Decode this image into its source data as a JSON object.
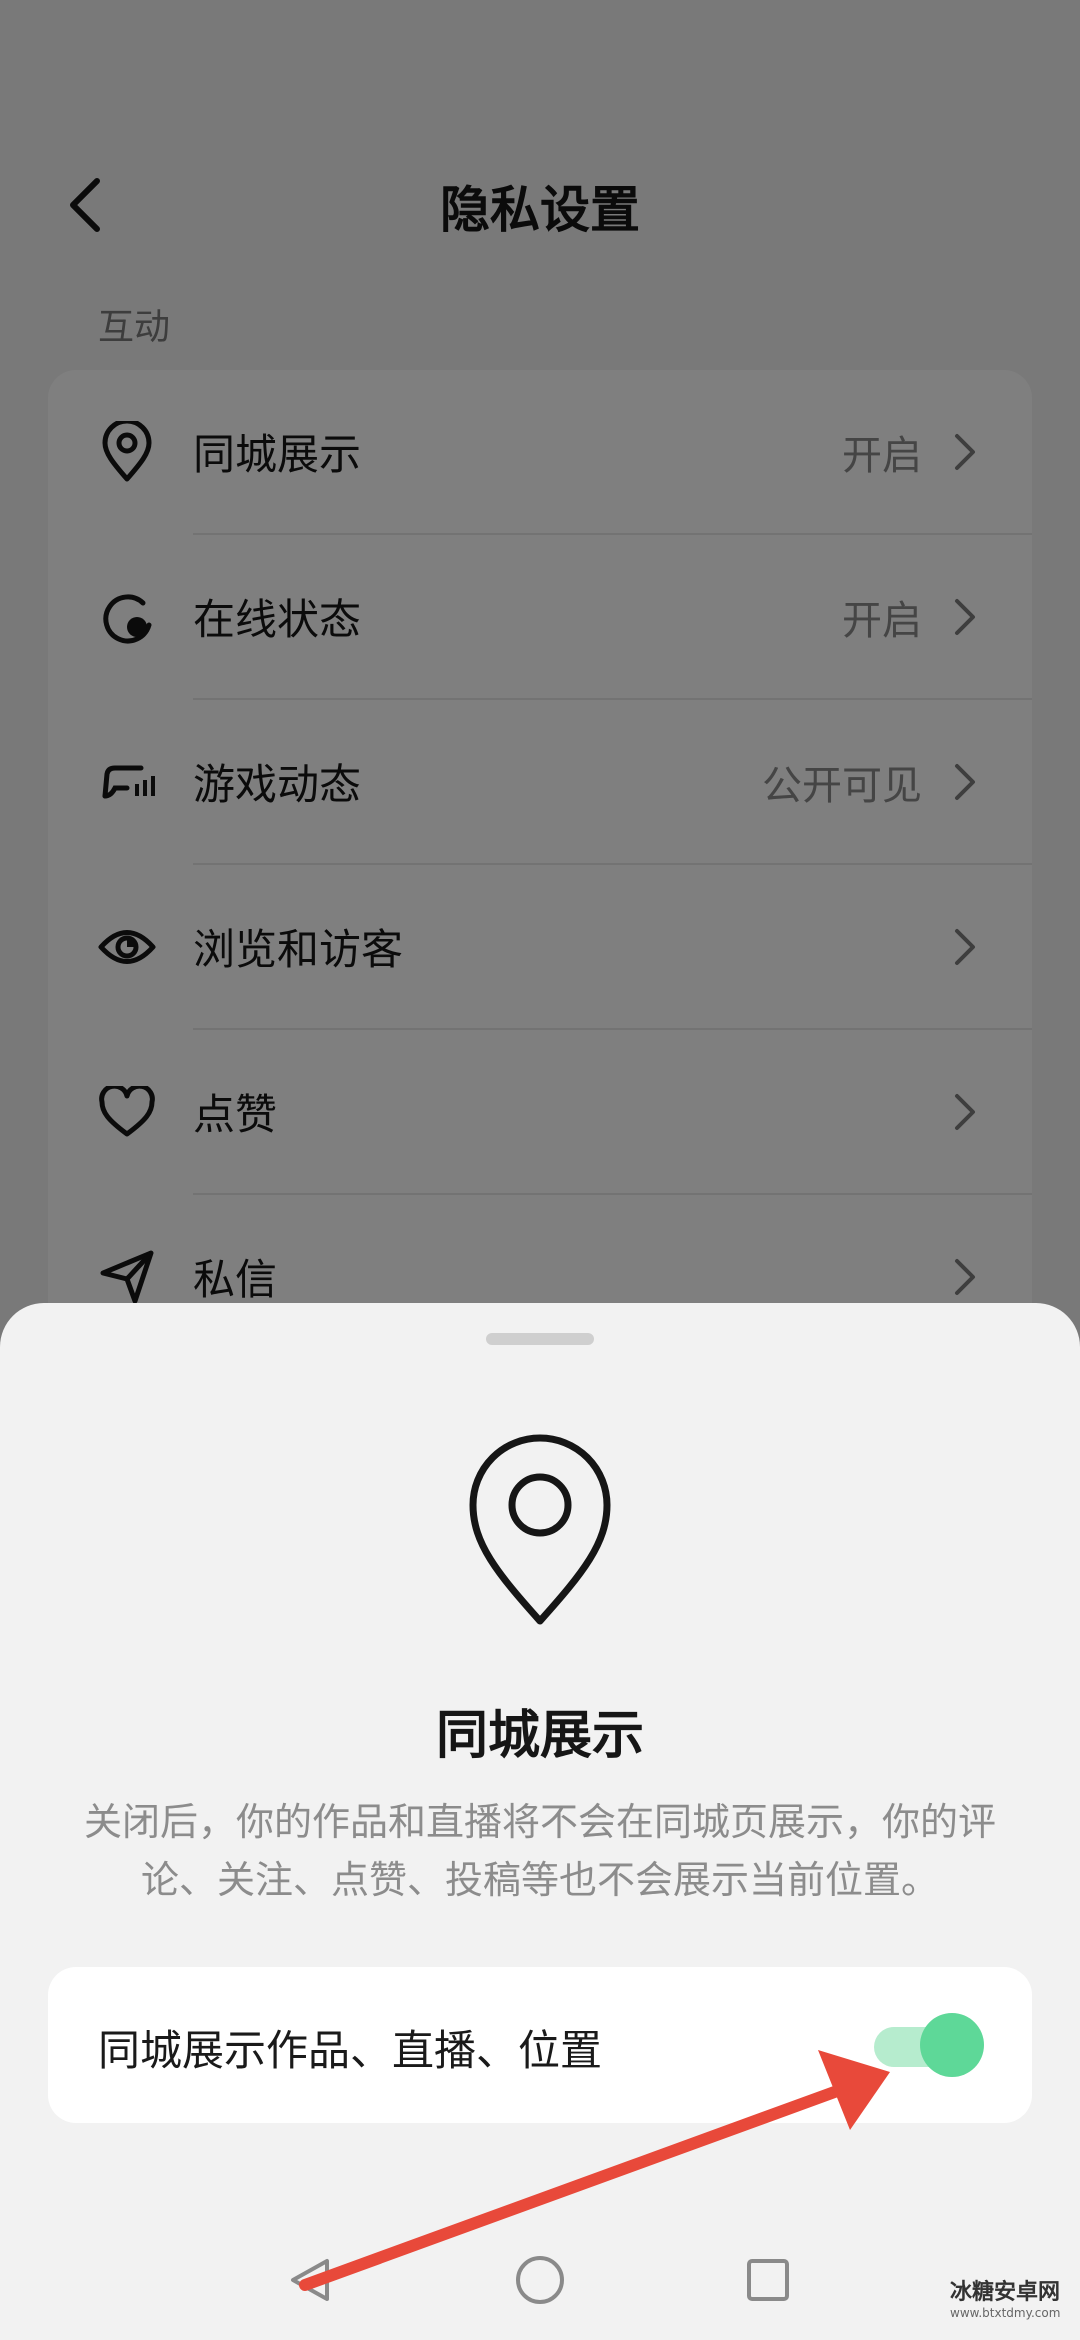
{
  "header": {
    "title": "隐私设置"
  },
  "section": {
    "label": "互动"
  },
  "settings": [
    {
      "icon": "location-pin-icon",
      "label": "同城展示",
      "value": "开启"
    },
    {
      "icon": "online-status-icon",
      "label": "在线状态",
      "value": "开启"
    },
    {
      "icon": "game-controller-icon",
      "label": "游戏动态",
      "value": "公开可见"
    },
    {
      "icon": "eye-icon",
      "label": "浏览和访客",
      "value": ""
    },
    {
      "icon": "heart-icon",
      "label": "点赞",
      "value": ""
    },
    {
      "icon": "paper-plane-icon",
      "label": "私信",
      "value": ""
    }
  ],
  "sheet": {
    "icon": "location-pin-icon",
    "title": "同城展示",
    "description": "关闭后，你的作品和直播将不会在同城页展示，你的评论、关注、点赞、投稿等也不会展示当前位置。",
    "toggle_label": "同城展示作品、直播、位置",
    "toggle_on": true
  },
  "colors": {
    "toggle_knob": "#5ed898",
    "toggle_track": "#b6ecce",
    "annotation_arrow": "#e8493a"
  },
  "navbar": {
    "buttons": [
      "back-triangle-icon",
      "home-circle-icon",
      "recents-square-icon"
    ]
  },
  "watermark": {
    "name": "冰糖安卓网",
    "url": "www.btxtdmy.com"
  }
}
